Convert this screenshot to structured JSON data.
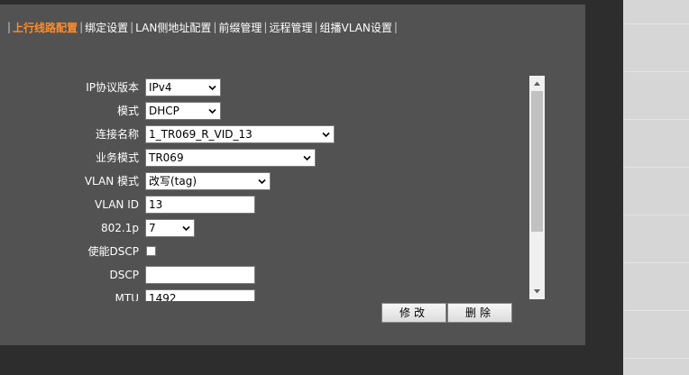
{
  "tabs": [
    {
      "label": "上行线路配置",
      "active": true
    },
    {
      "label": "绑定设置",
      "active": false
    },
    {
      "label": "LAN侧地址配置",
      "active": false
    },
    {
      "label": "前缀管理",
      "active": false
    },
    {
      "label": "远程管理",
      "active": false
    },
    {
      "label": "组播VLAN设置",
      "active": false
    }
  ],
  "separator": "|",
  "form": {
    "ip_version": {
      "label": "IP协议版本",
      "value": "IPv4"
    },
    "mode": {
      "label": "模式",
      "value": "DHCP"
    },
    "connection_name": {
      "label": "连接名称",
      "value": "1_TR069_R_VID_13"
    },
    "service_mode": {
      "label": "业务模式",
      "value": "TR069"
    },
    "vlan_mode": {
      "label": "VLAN 模式",
      "value": "改写(tag)"
    },
    "vlan_id": {
      "label": "VLAN ID",
      "value": "13"
    },
    "priority_8021p": {
      "label": "802.1p",
      "value": "7"
    },
    "enable_dscp": {
      "label": "使能DSCP",
      "checked": false
    },
    "dscp": {
      "label": "DSCP",
      "value": ""
    },
    "mtu": {
      "label": "MTU",
      "value": "1492"
    }
  },
  "buttons": {
    "modify": "修改",
    "delete": "删除"
  },
  "colors": {
    "panel_bg": "#525252",
    "active_tab": "#ff8c2a",
    "page_bg": "#2d2d2d"
  }
}
